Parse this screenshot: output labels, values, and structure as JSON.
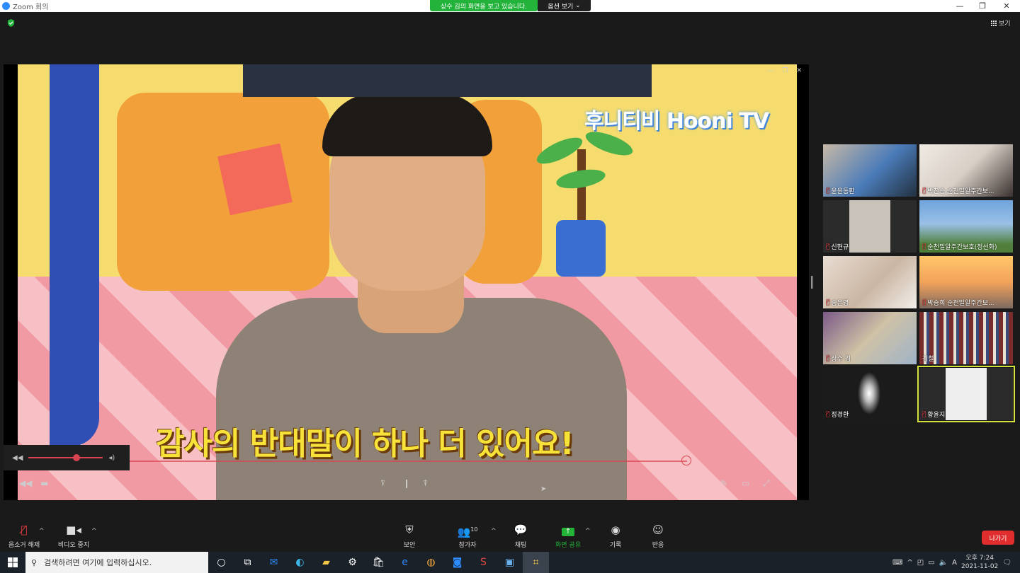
{
  "window": {
    "title": "Zoom 회의"
  },
  "share_banner": {
    "text": "상수 김의 화면을 보고 있습니다.",
    "options_label": "옵션 보기"
  },
  "view_label": "보기",
  "shared_screen": {
    "channel_title": "후니티비 Hooni TV",
    "subtitle": "감사의 반대말이 하나 더 있어요!"
  },
  "participants": [
    {
      "name": "윤윤동환",
      "muted": true
    },
    {
      "name": "박찬송 순천밀알주간보...",
      "muted": true
    },
    {
      "name": "신현규",
      "muted": true
    },
    {
      "name": "순천밀알주간보호(정선화)",
      "muted": true
    },
    {
      "name": "송은영",
      "muted": true
    },
    {
      "name": "박승희 순천밀알주간보...",
      "muted": true
    },
    {
      "name": "상수 김",
      "muted": true
    },
    {
      "name": "김철",
      "muted": false
    },
    {
      "name": "정경환",
      "muted": true
    },
    {
      "name": "황윤지",
      "muted": true,
      "active_speaker": true
    }
  ],
  "toolbar": {
    "unmute": "음소거 해제",
    "stop_video": "비디오 중지",
    "security": "보안",
    "participants": "참가자",
    "participants_count": "10",
    "chat": "채팅",
    "share_screen": "화면 공유",
    "record": "기록",
    "reactions": "반응",
    "leave": "나가기"
  },
  "taskbar": {
    "search_placeholder": "검색하려면 여기에 입력하십시오.",
    "time": "오후 7:24",
    "date": "2021-11-02",
    "ime": "A"
  },
  "colors": {
    "share_green": "#23b33a",
    "leave_red": "#e02e2e",
    "active_speaker": "#d4e23a",
    "zoom_blue": "#2d8cff"
  }
}
